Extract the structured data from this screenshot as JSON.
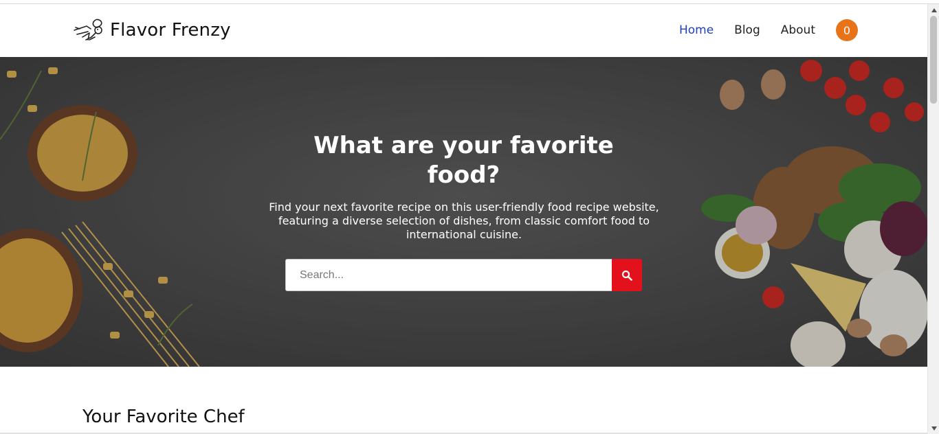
{
  "brand": {
    "name": "Flavor Frenzy",
    "logo_icon": "chef-hat-icon"
  },
  "nav": {
    "items": [
      {
        "label": "Home",
        "active": true
      },
      {
        "label": "Blog",
        "active": false
      },
      {
        "label": "About",
        "active": false
      }
    ],
    "cart_count": "0"
  },
  "hero": {
    "title_line1": "What are your favorite",
    "title_line2": "food?",
    "subtitle": "Find your next favorite recipe on this user-friendly food recipe website, featuring a diverse selection of dishes, from classic comfort food to international cuisine.",
    "search_placeholder": "Search...",
    "search_icon": "search-icon"
  },
  "sections": {
    "chef_title": "Your Favorite Chef"
  },
  "colors": {
    "nav_active": "#1e3fb8",
    "cart_badge": "#e8741a",
    "search_button": "#e3111b"
  }
}
